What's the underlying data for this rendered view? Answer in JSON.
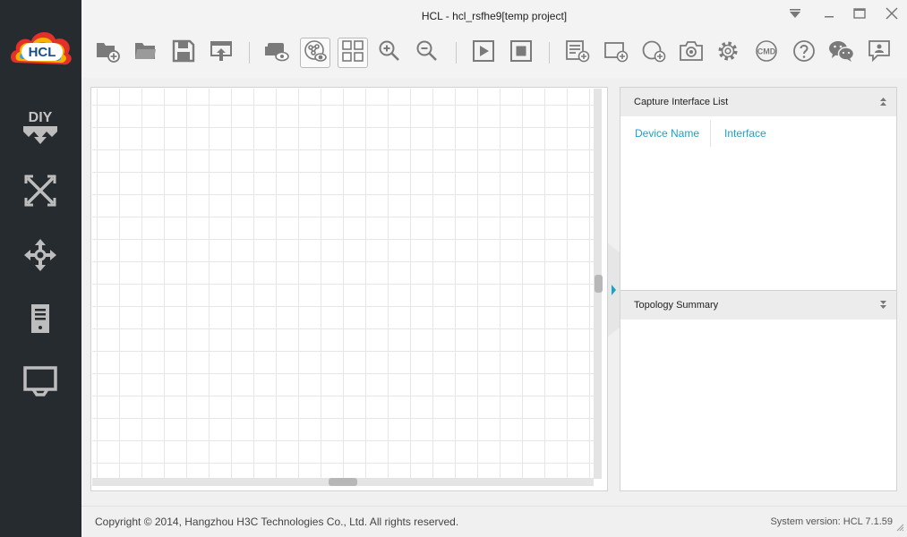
{
  "app": {
    "window_title": "HCL - hcl_rsfhe9[temp project]",
    "logo_text": "HCL"
  },
  "sidebar": {
    "items": [
      {
        "id": "diy",
        "label": "DIY",
        "icon": "diy-icon"
      },
      {
        "id": "routers",
        "icon": "router-arrows-icon"
      },
      {
        "id": "switches",
        "icon": "switch-arrows-icon"
      },
      {
        "id": "servers",
        "icon": "server-icon"
      },
      {
        "id": "hosts",
        "icon": "monitor-icon"
      }
    ]
  },
  "toolbar": {
    "buttons": [
      {
        "id": "new-project",
        "icon": "folder-add-icon"
      },
      {
        "id": "open-project",
        "icon": "folder-open-icon"
      },
      {
        "id": "save",
        "icon": "save-icon"
      },
      {
        "id": "export",
        "icon": "export-icon"
      },
      {
        "id": "show-labels",
        "icon": "label-eye-icon"
      },
      {
        "id": "topology-view",
        "icon": "topology-view-icon",
        "active": true
      },
      {
        "id": "grid-view",
        "icon": "grid-view-icon",
        "active": true
      },
      {
        "id": "zoom-in",
        "icon": "zoom-in-icon"
      },
      {
        "id": "zoom-out",
        "icon": "zoom-out-icon"
      },
      {
        "id": "start",
        "icon": "play-icon"
      },
      {
        "id": "stop",
        "icon": "stop-icon"
      },
      {
        "id": "add-note",
        "icon": "note-add-icon"
      },
      {
        "id": "add-rectangle",
        "icon": "rectangle-add-icon"
      },
      {
        "id": "add-ellipse",
        "icon": "ellipse-add-icon"
      },
      {
        "id": "screenshot",
        "icon": "camera-icon"
      },
      {
        "id": "settings",
        "icon": "gear-icon"
      },
      {
        "id": "cmd",
        "icon": "cmd-icon",
        "label": "CMD"
      },
      {
        "id": "help",
        "icon": "help-icon"
      },
      {
        "id": "wechat",
        "icon": "wechat-icon"
      },
      {
        "id": "feedback",
        "icon": "feedback-icon"
      }
    ]
  },
  "capture_panel": {
    "title": "Capture Interface List",
    "columns": [
      "Device Name",
      "Interface"
    ]
  },
  "topology_panel": {
    "title": "Topology Summary"
  },
  "status": {
    "copyright": "Copyright © 2014, Hangzhou H3C Technologies Co., Ltd. All rights reserved.",
    "version": "System version: HCL 7.1.59"
  },
  "colors": {
    "sidebar_bg": "#262b30",
    "accent": "#1aa2c8",
    "icon_gray": "#7a7a7a",
    "sidebar_icon": "#bfbfbf"
  }
}
